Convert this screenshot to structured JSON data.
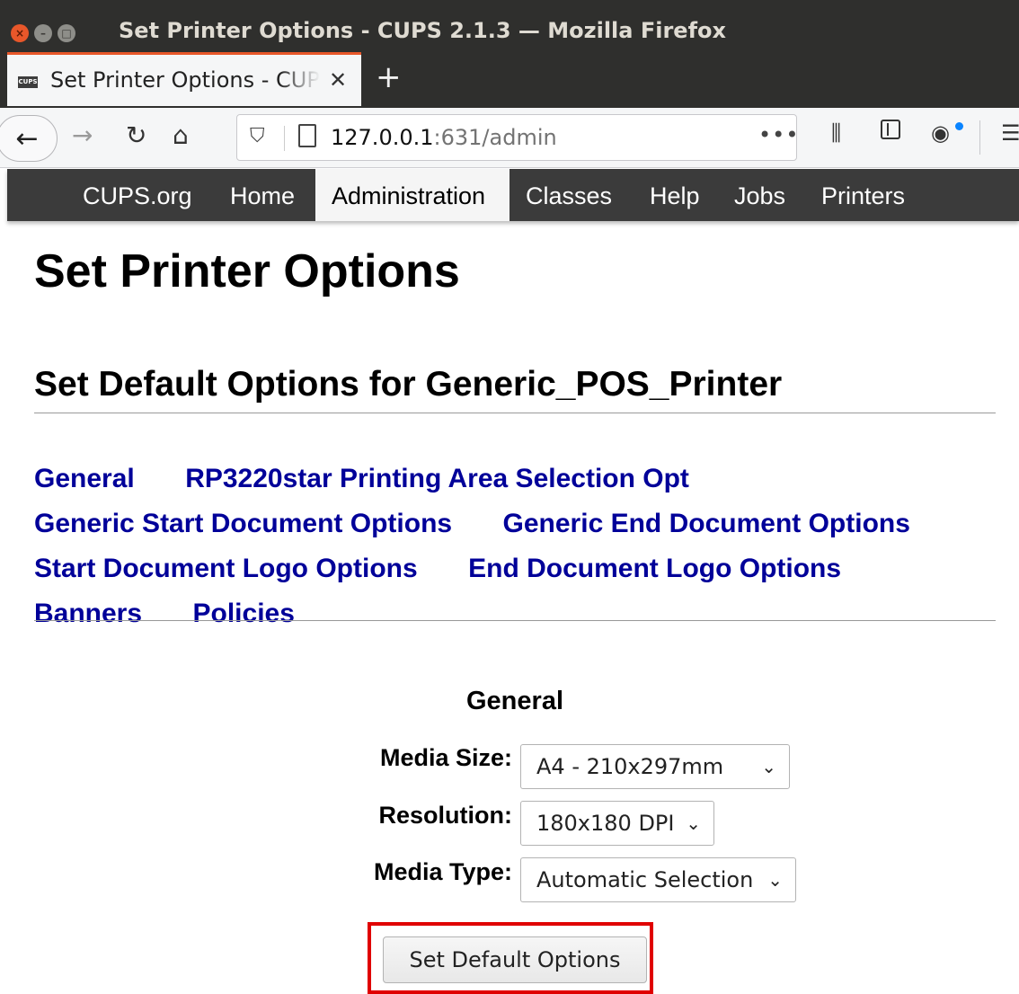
{
  "window": {
    "title": "Set Printer Options - CUPS 2.1.3 — Mozilla Firefox"
  },
  "tabs": [
    {
      "favicon_text": "CUPS",
      "title": "Set Printer Options - CUPS 2.1.3",
      "active": true
    }
  ],
  "toolbar": {
    "url_host": "127.0.0.1",
    "url_rest": ":631/admin",
    "page_actions": "•••"
  },
  "cups_nav": {
    "items": [
      {
        "label": "CUPS.org",
        "active": false
      },
      {
        "label": "Home",
        "active": false
      },
      {
        "label": "Administration",
        "active": true
      },
      {
        "label": "Classes",
        "active": false
      },
      {
        "label": "Help",
        "active": false
      },
      {
        "label": "Jobs",
        "active": false
      },
      {
        "label": "Printers",
        "active": false
      }
    ]
  },
  "page": {
    "title": "Set Printer Options",
    "subtitle": "Set Default Options for Generic_POS_Printer",
    "section_links": [
      "General",
      "RP3220star Printing Area Selection Opt",
      "Generic Start Document Options",
      "Generic End Document Options",
      "Start Document Logo Options",
      "End Document Logo Options",
      "Banners",
      "Policies"
    ],
    "form": {
      "heading": "General",
      "options": [
        {
          "label": "Media Size:",
          "value": "A4 - 210x297mm"
        },
        {
          "label": "Resolution:",
          "value": "180x180 DPI"
        },
        {
          "label": "Media Type:",
          "value": "Automatic Selection"
        }
      ],
      "submit_label": "Set Default Options"
    }
  },
  "colors": {
    "link": "#000099",
    "highlight": "#e00000",
    "cups_nav_bg": "#3b3b3b"
  }
}
